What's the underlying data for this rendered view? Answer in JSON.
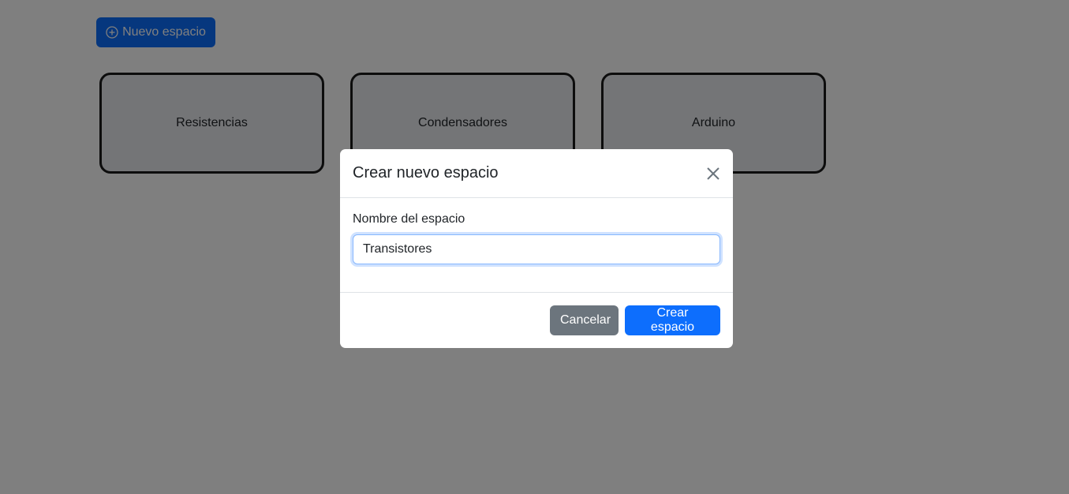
{
  "toolbar": {
    "new_space_label": "Nuevo espacio",
    "new_space_icon": "plus-circle-icon"
  },
  "spaces": [
    {
      "name": "Resistencias"
    },
    {
      "name": "Condensadores"
    },
    {
      "name": "Arduino"
    }
  ],
  "modal": {
    "title": "Crear nuevo espacio",
    "close_icon": "close-icon",
    "field_label": "Nombre del espacio",
    "input_value": "Transistores",
    "cancel_label": "Cancelar",
    "submit_label": "Crear espacio"
  },
  "colors": {
    "primary": "#0d6efd",
    "secondary": "#6c757d",
    "backdrop": "rgba(0,0,0,0.5)"
  }
}
